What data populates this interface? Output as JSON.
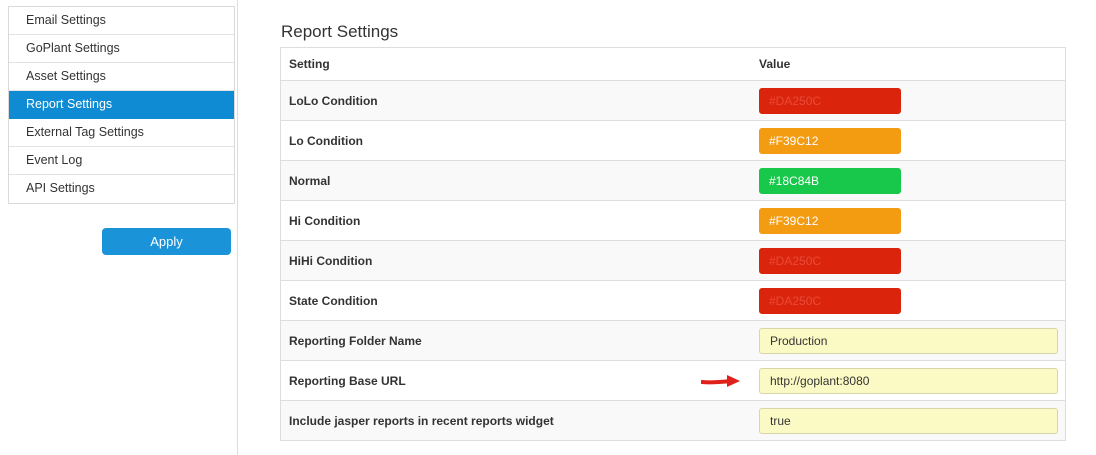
{
  "sidebar": {
    "items": [
      {
        "label": "Email Settings"
      },
      {
        "label": "GoPlant Settings"
      },
      {
        "label": "Asset Settings"
      },
      {
        "label": "Report Settings",
        "active": true
      },
      {
        "label": "External Tag Settings"
      },
      {
        "label": "Event Log"
      },
      {
        "label": "API Settings"
      }
    ],
    "apply_label": "Apply"
  },
  "main": {
    "title": "Report Settings",
    "table": {
      "headers": {
        "setting": "Setting",
        "value": "Value"
      },
      "color_rows": [
        {
          "setting": "LoLo Condition",
          "value": "#DA250C",
          "color": "#DA250C"
        },
        {
          "setting": "Lo Condition",
          "value": "#F39C12",
          "color": "#F39C12"
        },
        {
          "setting": "Normal",
          "value": "#18C84B",
          "color": "#18C84B"
        },
        {
          "setting": "Hi Condition",
          "value": "#F39C12",
          "color": "#F39C12"
        },
        {
          "setting": "HiHi Condition",
          "value": "#DA250C",
          "color": "#DA250C"
        },
        {
          "setting": "State Condition",
          "value": "#DA250C",
          "color": "#DA250C"
        }
      ],
      "text_rows": [
        {
          "setting": "Reporting Folder Name",
          "value": "Production"
        },
        {
          "setting": "Reporting Base URL",
          "value": "http://goplant:8080"
        },
        {
          "setting": "Include jasper reports in recent reports widget",
          "value": "true"
        }
      ]
    }
  },
  "colors": {
    "accent": "#0E8BD2",
    "input_bg": "#FCFAC4",
    "annotation_arrow": "#E0201B"
  },
  "icons": {
    "annotation": "red-arrow-icon"
  }
}
